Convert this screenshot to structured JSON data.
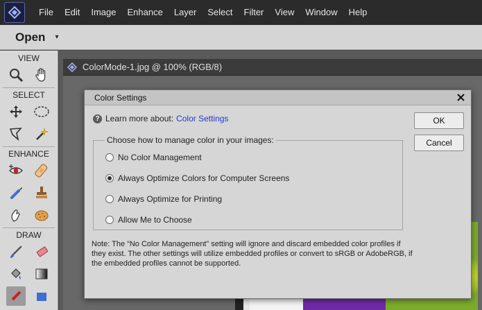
{
  "menubar": {
    "items": [
      "File",
      "Edit",
      "Image",
      "Enhance",
      "Layer",
      "Select",
      "Filter",
      "View",
      "Window",
      "Help"
    ]
  },
  "openbar": {
    "open_label": "Open",
    "caret": "▾"
  },
  "toolbox": {
    "sections": {
      "view": "VIEW",
      "select": "SELECT",
      "enhance": "ENHANCE",
      "draw": "DRAW"
    },
    "tools": {
      "view": [
        "zoom-icon",
        "hand-icon"
      ],
      "select": [
        "move-icon",
        "elliptical-marquee-icon",
        "lasso-icon",
        "magic-wand-icon"
      ],
      "enhance": [
        "red-eye-icon",
        "spot-healing-icon",
        "smart-brush-icon",
        "clone-stamp-icon",
        "smudge-icon",
        "sponge-icon"
      ],
      "draw": [
        "brush-icon",
        "eraser-icon",
        "paint-bucket-icon",
        "gradient-icon",
        "pencil-icon",
        "shape-icon"
      ]
    }
  },
  "document": {
    "tab_title": "ColorMode-1.jpg @ 100% (RGB/8)"
  },
  "dialog": {
    "title": "Color Settings",
    "close_glyph": "✕",
    "learn_prefix": "Learn more about:",
    "learn_link": "Color Settings",
    "ok_label": "OK",
    "cancel_label": "Cancel",
    "group_legend": "Choose how to manage color in your images:",
    "options": [
      {
        "label": "No Color Management",
        "checked": false
      },
      {
        "label": "Always Optimize Colors for Computer Screens",
        "checked": true
      },
      {
        "label": "Always Optimize for Printing",
        "checked": false
      },
      {
        "label": "Allow Me to Choose",
        "checked": false
      }
    ],
    "note": "Note: The “No Color Management” setting will ignore and discard embedded color profiles if they exist. The other settings will utilize embedded profiles or convert to sRGB or AdobeRGB, if the embedded profiles cannot be supported."
  }
}
